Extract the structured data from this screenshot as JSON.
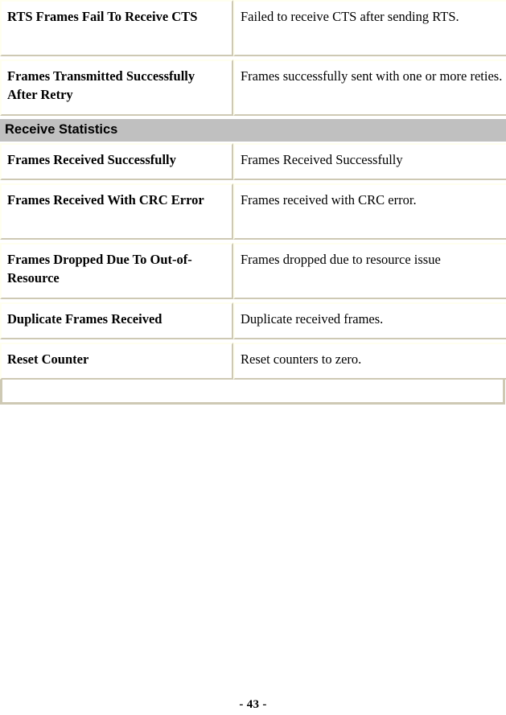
{
  "document": {
    "page_number_label": "- 43 -"
  },
  "table": {
    "section_header": "Receive Statistics",
    "rows_before_section": [
      {
        "label": "RTS Frames Fail To Receive CTS",
        "description": "Failed to receive CTS after sending RTS.",
        "lines": 2
      },
      {
        "label": "Frames Transmitted Successfully After Retry",
        "description": "Frames successfully sent with one or more reties.",
        "lines": 2
      }
    ],
    "rows_after_section": [
      {
        "label": "Frames Received Successfully",
        "description": "Frames Received Successfully",
        "lines": 1
      },
      {
        "label": "Frames Received With CRC Error",
        "description": "Frames received with CRC error.",
        "lines": 2
      },
      {
        "label": "Frames Dropped Due To Out-of-Resource",
        "description": "Frames dropped due to resource issue",
        "lines": 2
      },
      {
        "label": "Duplicate Frames Received",
        "description": "Duplicate received frames.",
        "lines": 1
      },
      {
        "label": "Reset Counter",
        "description": "Reset counters to zero.",
        "lines": 1
      }
    ]
  },
  "colors": {
    "border_light": "#ffffef",
    "border_dark": "#cec9b4",
    "section_band_bg": "#c0c0c0",
    "section_band_edge": "#5e5e5a",
    "page_bg": "#ffffff",
    "text": "#000000"
  }
}
